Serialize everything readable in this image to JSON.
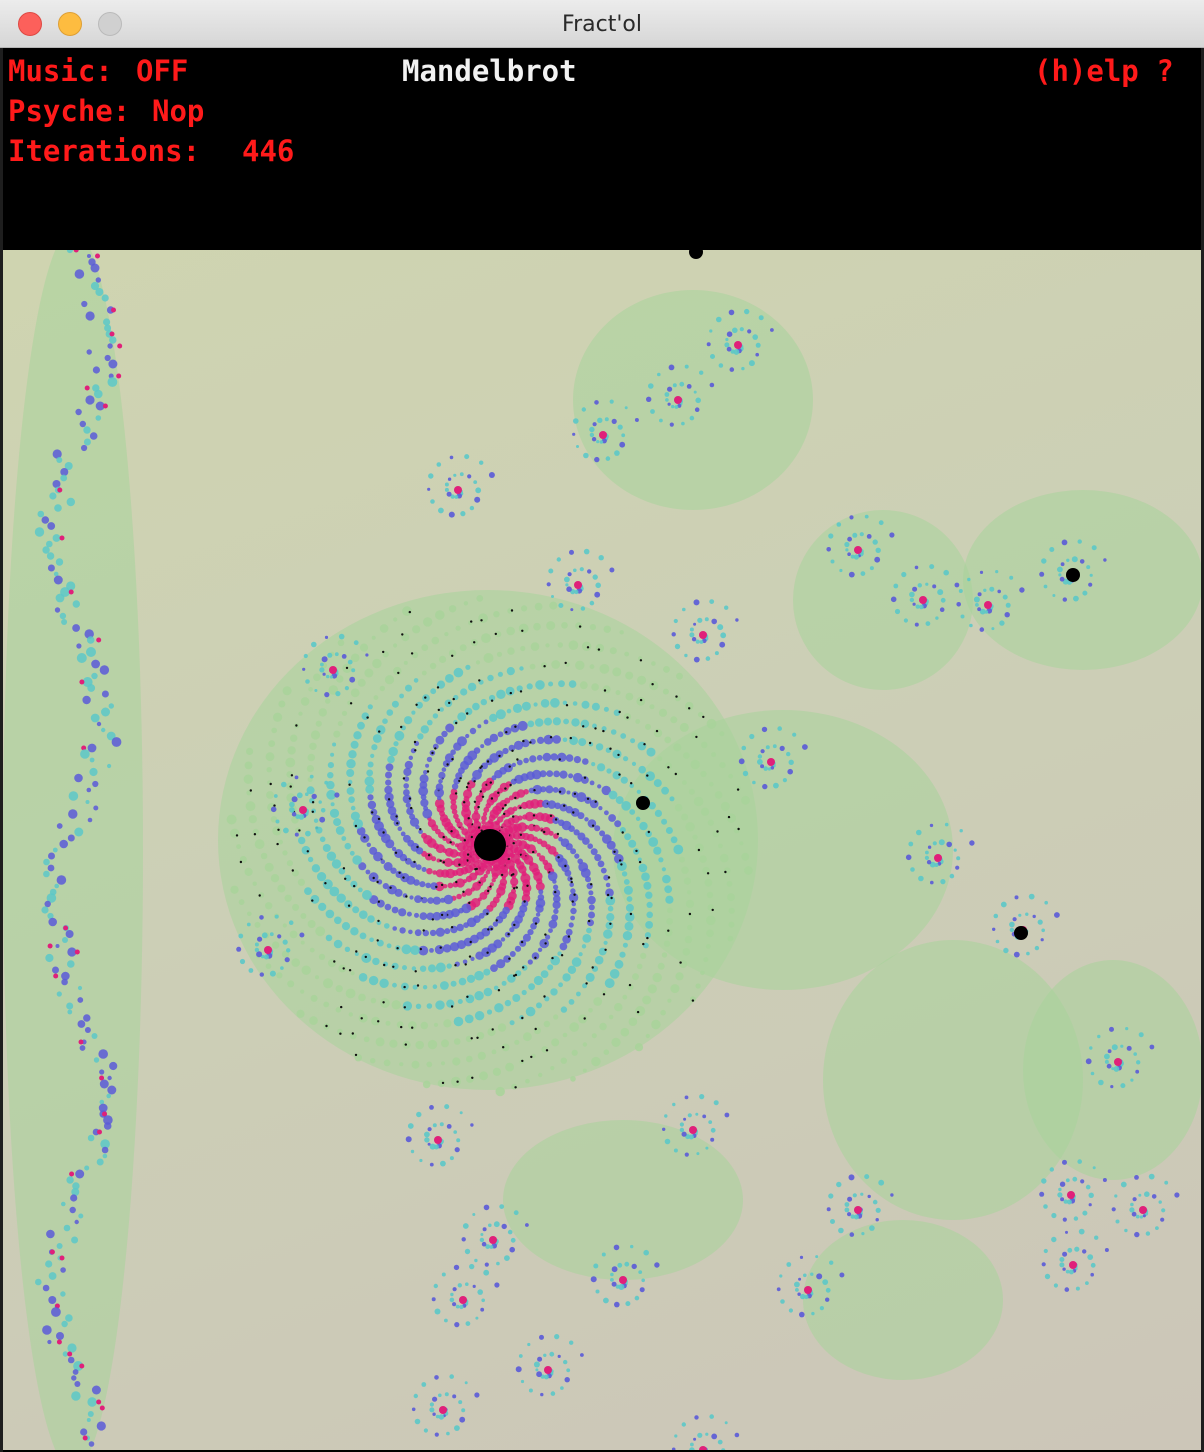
{
  "window": {
    "title": "Fract'ol"
  },
  "hud": {
    "music_label": "Music:",
    "music_value": "OFF",
    "fractal_name": "Mandelbrot",
    "help_label": "(h)elp ?",
    "psyche_label": "Psyche:",
    "psyche_value": "Nop",
    "iterations_label": "Iterations:",
    "iterations_value": "446"
  },
  "colors": {
    "hud_text": "#ff1a1a",
    "hud_title": "#f2f2f2",
    "hud_background": "#000000",
    "fractal_background": "#ccccb4",
    "fractal_green": "#a8d49a",
    "fractal_cyan": "#5cc8c8",
    "fractal_blue": "#5a5ad8",
    "fractal_magenta": "#e0207a"
  }
}
